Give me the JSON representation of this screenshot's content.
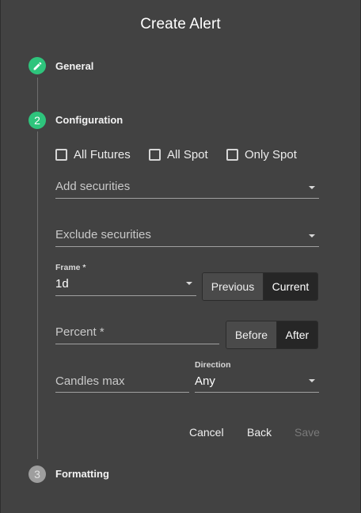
{
  "dialog": {
    "title": "Create Alert"
  },
  "steps": [
    {
      "number": "",
      "label": "General",
      "icon": "pencil-icon",
      "state": "done"
    },
    {
      "number": "2",
      "label": "Configuration",
      "state": "active"
    },
    {
      "number": "3",
      "label": "Formatting",
      "state": "pending"
    }
  ],
  "filters": {
    "all_futures": {
      "label": "All Futures",
      "checked": false
    },
    "all_spot": {
      "label": "All Spot",
      "checked": false
    },
    "only_spot": {
      "label": "Only Spot",
      "checked": false
    }
  },
  "add_securities": {
    "placeholder": "Add securities"
  },
  "exclude_securities": {
    "placeholder": "Exclude securities"
  },
  "frame": {
    "label": "Frame *",
    "value": "1d"
  },
  "frame_toggle": {
    "options": [
      "Previous",
      "Current"
    ],
    "selected": "Current"
  },
  "percent": {
    "placeholder": "Percent *"
  },
  "position_toggle": {
    "options": [
      "Before",
      "After"
    ],
    "selected": "After"
  },
  "candles_max": {
    "placeholder": "Candles max"
  },
  "direction": {
    "label": "Direction",
    "value": "Any"
  },
  "actions": {
    "cancel": "Cancel",
    "back": "Back",
    "save": "Save",
    "save_disabled": true
  },
  "colors": {
    "accent": "#2ec47c",
    "background": "#424242",
    "pending_step": "#9e9e9e"
  }
}
